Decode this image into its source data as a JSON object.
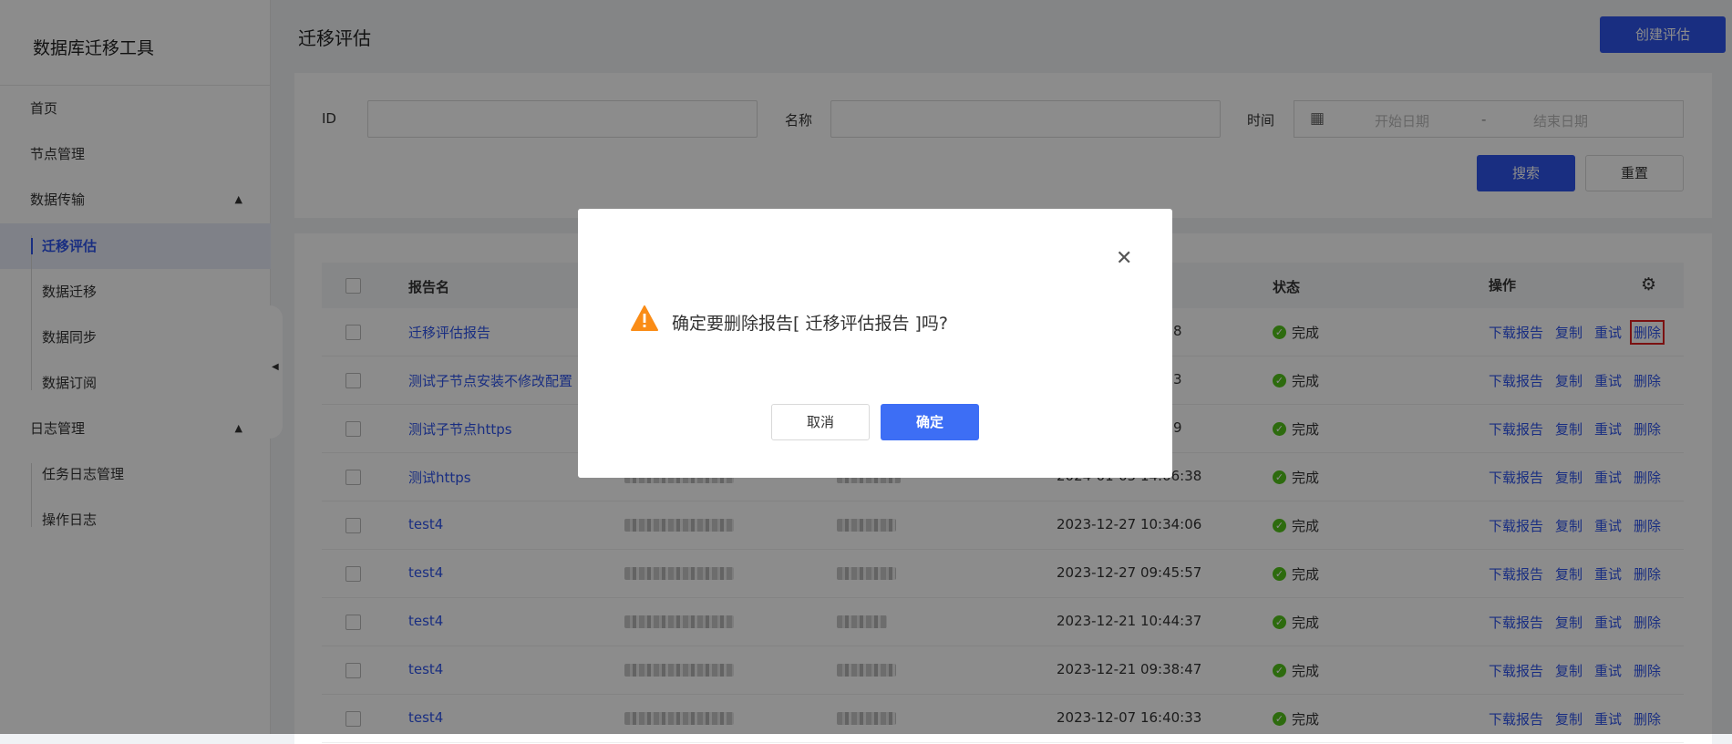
{
  "app": {
    "title": "数据库迁移工具"
  },
  "sidebar": {
    "items": [
      {
        "label": "首页"
      },
      {
        "label": "节点管理"
      },
      {
        "label": "数据传输"
      },
      {
        "label": "迁移评估"
      },
      {
        "label": "数据迁移"
      },
      {
        "label": "数据同步"
      },
      {
        "label": "数据订阅"
      },
      {
        "label": "日志管理"
      },
      {
        "label": "任务日志管理"
      },
      {
        "label": "操作日志"
      }
    ]
  },
  "header": {
    "title": "迁移评估",
    "create_label": "创建评估"
  },
  "filters": {
    "id_label": "ID",
    "name_label": "名称",
    "time_label": "时间",
    "start_placeholder": "开始日期",
    "range_separator": "-",
    "end_placeholder": "结束日期",
    "search_label": "搜索",
    "reset_label": "重置"
  },
  "table": {
    "columns": {
      "name": "报告名",
      "status": "状态",
      "actions": "操作"
    },
    "rows": [
      {
        "name": "迁移评估报告",
        "time": "8",
        "status": "完成"
      },
      {
        "name": "测试子节点安装不修改配置",
        "time": "3",
        "status": "完成"
      },
      {
        "name": "测试子节点https",
        "time": "9",
        "status": "完成"
      },
      {
        "name": "测试https",
        "time": "2024-01-05 14:06:38",
        "status": "完成"
      },
      {
        "name": "test4",
        "time": "2023-12-27 10:34:06",
        "status": "完成"
      },
      {
        "name": "test4",
        "time": "2023-12-27 09:45:57",
        "status": "完成"
      },
      {
        "name": "test4",
        "time": "2023-12-21 10:44:37",
        "status": "完成"
      },
      {
        "name": "test4",
        "time": "2023-12-21 09:38:47",
        "status": "完成"
      },
      {
        "name": "test4",
        "time": "2023-12-07 16:40:33",
        "status": "完成"
      }
    ],
    "actions": {
      "download": "下载报告",
      "copy": "复制",
      "retry": "重试",
      "delete": "删除"
    }
  },
  "modal": {
    "message": "确定要删除报告[ 迁移评估报告 ]吗?",
    "cancel_label": "取消",
    "ok_label": "确定"
  },
  "colors": {
    "accent": "#2f54eb",
    "success": "#52c41a",
    "warning": "#fa8c16",
    "highlight": "#e02020"
  }
}
